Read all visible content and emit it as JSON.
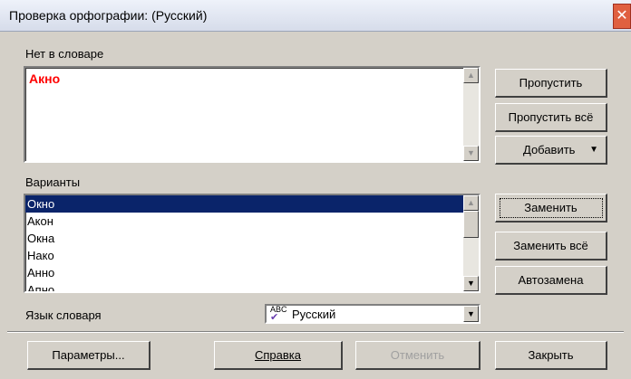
{
  "window": {
    "title": "Проверка орфографии: (Русский)"
  },
  "not_in_dict": {
    "label": "Нет в словаре",
    "word": "Акно"
  },
  "variants": {
    "label": "Варианты",
    "items": [
      "Окно",
      "Акон",
      "Окна",
      "Нако",
      "Анно",
      "Апно"
    ],
    "selected_index": 0
  },
  "language": {
    "label": "Язык словаря",
    "value": "Русский",
    "icon": "abc-check-icon"
  },
  "buttons": {
    "skip": "Пропустить",
    "skip_all": "Пропустить всё",
    "add": "Добавить",
    "replace": "Заменить",
    "replace_all": "Заменить всё",
    "autocorrect": "Автозамена",
    "options": "Параметры...",
    "help": "Справка",
    "undo": "Отменить",
    "close": "Закрыть"
  },
  "colors": {
    "selection": "#0a246a",
    "error_word": "#ff0000"
  }
}
